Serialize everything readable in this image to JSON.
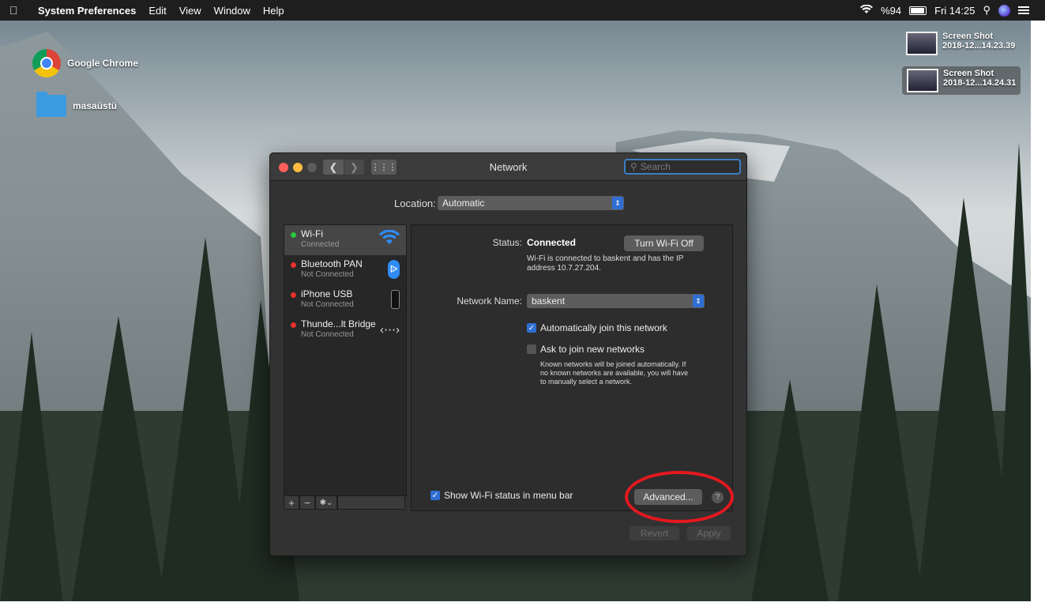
{
  "menubar": {
    "apple_icon": "apple-icon",
    "items": [
      "System Preferences",
      "Edit",
      "View",
      "Window",
      "Help"
    ],
    "wifi_icon": "wifi-icon",
    "battery_percent": "%94",
    "clock": "Fri 14:25"
  },
  "desktop": {
    "chrome_label": "Google Chrome",
    "folder_label": "masaüstü",
    "screenshots": [
      {
        "line1": "Screen Shot",
        "line2": "2018-12...14.23.39"
      },
      {
        "line1": "Screen Shot",
        "line2": "2018-12...14.24.31"
      }
    ]
  },
  "window": {
    "title": "Network",
    "search_placeholder": "Search",
    "location_label": "Location:",
    "location_value": "Automatic",
    "services": [
      {
        "name": "Wi-Fi",
        "status": "Connected",
        "dot": "green"
      },
      {
        "name": "Bluetooth PAN",
        "status": "Not Connected",
        "dot": "red"
      },
      {
        "name": "iPhone USB",
        "status": "Not Connected",
        "dot": "red"
      },
      {
        "name": "Thunde...lt Bridge",
        "status": "Not Connected",
        "dot": "red"
      }
    ],
    "toolbar": {
      "add": "+",
      "remove": "−",
      "action": "✱⌄"
    },
    "detail": {
      "status_label": "Status:",
      "status_value": "Connected",
      "turn_off_button": "Turn Wi-Fi Off",
      "status_desc_1": "Wi-Fi is connected to baskent and has the IP",
      "status_desc_2": "address 10.7.27.204.",
      "network_name_label": "Network Name:",
      "network_name_value": "baskent",
      "auto_join_label": "Automatically join this network",
      "auto_join_checked": true,
      "ask_join_label": "Ask to join new networks",
      "ask_join_checked": false,
      "ask_desc_1": "Known networks will be joined automatically. If",
      "ask_desc_2": "no known networks are available, you will have",
      "ask_desc_3": "to manually select a network.",
      "show_status_label": "Show Wi-Fi status in menu bar",
      "show_status_checked": true,
      "advanced_button": "Advanced...",
      "help": "?"
    },
    "revert_button": "Revert",
    "apply_button": "Apply"
  },
  "colors": {
    "accent": "#2f6fd3",
    "annotation": "#e5181f",
    "connected": "#28c840",
    "not_connected": "#e8302c"
  }
}
